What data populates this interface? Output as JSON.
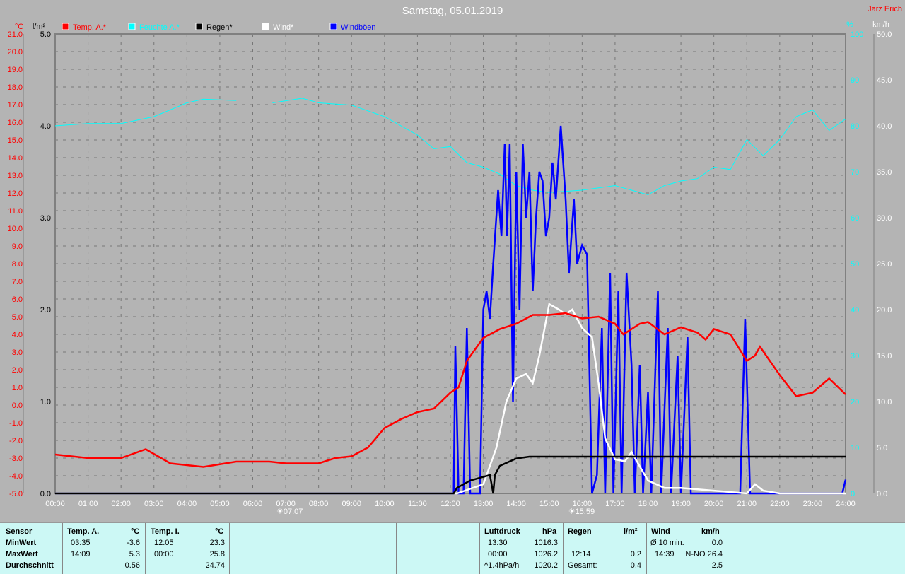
{
  "title": "Samstag, 05.01.2019",
  "author": "Jarz Erich",
  "colors": {
    "temp": "#ff0000",
    "hum": "#00ffff",
    "rain": "#000000",
    "wind": "#ffffff",
    "gust": "#0000ff"
  },
  "chart_data": {
    "type": "line",
    "title": "Samstag, 05.01.2019",
    "legend": [
      "Temp. A.*",
      "Feuchte A.*",
      "Regen*",
      "Wind*",
      "Windböen"
    ],
    "legend_placement": "top-left",
    "axes": {
      "left_temp": {
        "unit": "°C",
        "range": [
          -5,
          21
        ],
        "ticks": [
          "21.0",
          "20.0",
          "19.0",
          "18.0",
          "17.0",
          "16.0",
          "15.0",
          "14.0",
          "13.0",
          "12.0",
          "11.0",
          "10.0",
          "9.0",
          "8.0",
          "7.0",
          "6.0",
          "5.0",
          "4.0",
          "3.0",
          "2.0",
          "1.0",
          "0.0",
          "-1.0",
          "-2.0",
          "-3.0",
          "-4.0",
          "-5.0"
        ]
      },
      "left_rain": {
        "unit": "l/m²",
        "range": [
          0,
          5
        ],
        "ticks": [
          "5.0",
          "4.0",
          "3.0",
          "2.0",
          "1.0",
          "0.0"
        ]
      },
      "right_hum": {
        "unit": "%",
        "range": [
          0,
          100
        ],
        "ticks": [
          "100",
          "90",
          "80",
          "70",
          "60",
          "50",
          "40",
          "30",
          "20",
          "10",
          "0"
        ]
      },
      "right_wind": {
        "unit": "km/h",
        "range": [
          0,
          50
        ],
        "ticks": [
          "50.0",
          "45.0",
          "40.0",
          "35.0",
          "30.0",
          "25.0",
          "20.0",
          "15.0",
          "10.0",
          "5.0",
          "0.0"
        ]
      },
      "x": {
        "range": [
          0,
          24
        ],
        "ticks": [
          "00:00",
          "01:00",
          "02:00",
          "03:00",
          "04:00",
          "05:00",
          "06:00",
          "07:00",
          "08:00",
          "09:00",
          "10:00",
          "11:00",
          "12:00",
          "13:00",
          "14:00",
          "15:00",
          "16:00",
          "17:00",
          "18:00",
          "19:00",
          "20:00",
          "21:00",
          "22:00",
          "23:00",
          "24:00"
        ]
      }
    },
    "grid": true,
    "sun": [
      {
        "label": "07:07",
        "t": 7.12
      },
      {
        "label": "15:59",
        "t": 15.98
      }
    ],
    "series": [
      {
        "name": "Temp. A.",
        "axis": "left_temp",
        "points": [
          [
            0,
            -2.8
          ],
          [
            1,
            -3.0
          ],
          [
            2,
            -3.0
          ],
          [
            2.75,
            -2.5
          ],
          [
            3.5,
            -3.3
          ],
          [
            4.5,
            -3.5
          ],
          [
            5.5,
            -3.2
          ],
          [
            6.5,
            -3.2
          ],
          [
            7,
            -3.3
          ],
          [
            8,
            -3.3
          ],
          [
            8.5,
            -3.0
          ],
          [
            9,
            -2.9
          ],
          [
            9.5,
            -2.4
          ],
          [
            10,
            -1.3
          ],
          [
            10.5,
            -0.8
          ],
          [
            11,
            -0.4
          ],
          [
            11.5,
            -0.2
          ],
          [
            12,
            0.7
          ],
          [
            12.25,
            1.0
          ],
          [
            12.5,
            2.5
          ],
          [
            13,
            3.8
          ],
          [
            13.5,
            4.3
          ],
          [
            14,
            4.6
          ],
          [
            14.5,
            5.1
          ],
          [
            15,
            5.1
          ],
          [
            15.5,
            5.2
          ],
          [
            16,
            4.9
          ],
          [
            16.5,
            5.0
          ],
          [
            17,
            4.6
          ],
          [
            17.25,
            4.0
          ],
          [
            17.75,
            4.6
          ],
          [
            18,
            4.7
          ],
          [
            18.5,
            4.0
          ],
          [
            19,
            4.4
          ],
          [
            19.5,
            4.1
          ],
          [
            19.75,
            3.7
          ],
          [
            20,
            4.3
          ],
          [
            20.5,
            4.0
          ],
          [
            21,
            2.5
          ],
          [
            21.25,
            2.8
          ],
          [
            21.4,
            3.3
          ],
          [
            22,
            1.7
          ],
          [
            22.5,
            0.5
          ],
          [
            23,
            0.7
          ],
          [
            23.5,
            1.5
          ],
          [
            24,
            0.6
          ]
        ]
      },
      {
        "name": "Feuchte A.",
        "axis": "right_hum",
        "points": [
          [
            0,
            80
          ],
          [
            1,
            80.5
          ],
          [
            2,
            80.5
          ],
          [
            3,
            82
          ],
          [
            4,
            85
          ],
          [
            4.5,
            85.8
          ],
          [
            5.5,
            85.5
          ],
          [
            6.2,
            null
          ],
          [
            6.6,
            85
          ],
          [
            7.5,
            86
          ],
          [
            8,
            85
          ],
          [
            9,
            84.5
          ],
          [
            10,
            82
          ],
          [
            11,
            78
          ],
          [
            11.5,
            75
          ],
          [
            12,
            75.5
          ],
          [
            12.5,
            72
          ],
          [
            13,
            71
          ],
          [
            13.5,
            69.5
          ],
          [
            14,
            67
          ],
          [
            14.5,
            66
          ],
          [
            15,
            65.5
          ],
          [
            16,
            66
          ],
          [
            17,
            67
          ],
          [
            17.5,
            66
          ],
          [
            18,
            65
          ],
          [
            18.5,
            67
          ],
          [
            19,
            68
          ],
          [
            19.5,
            68.5
          ],
          [
            20,
            71
          ],
          [
            20.5,
            70.5
          ],
          [
            21,
            77
          ],
          [
            21.5,
            73.5
          ],
          [
            22,
            77
          ],
          [
            22.5,
            82
          ],
          [
            23,
            83.5
          ],
          [
            23.5,
            79
          ],
          [
            24,
            81.5
          ]
        ]
      },
      {
        "name": "Regen",
        "axis": "left_rain",
        "points": [
          [
            0,
            0
          ],
          [
            12.1,
            0
          ],
          [
            12.2,
            0.06
          ],
          [
            12.6,
            0.14
          ],
          [
            13,
            0.18
          ],
          [
            13.2,
            0.2
          ],
          [
            13.3,
            0.0
          ],
          [
            13.35,
            0.2
          ],
          [
            13.5,
            0.3
          ],
          [
            14,
            0.38
          ],
          [
            14.4,
            0.4
          ],
          [
            24,
            0.4
          ]
        ]
      },
      {
        "name": "Wind",
        "axis": "right_wind",
        "points": [
          [
            0,
            0
          ],
          [
            12.2,
            0
          ],
          [
            12.6,
            0.5
          ],
          [
            13,
            1
          ],
          [
            13.4,
            5
          ],
          [
            13.7,
            10
          ],
          [
            14,
            12.5
          ],
          [
            14.3,
            13
          ],
          [
            14.5,
            12
          ],
          [
            14.7,
            15
          ],
          [
            15,
            20.6
          ],
          [
            15.3,
            20
          ],
          [
            15.5,
            19.5
          ],
          [
            15.7,
            20
          ],
          [
            16,
            18
          ],
          [
            16.3,
            17
          ],
          [
            16.5,
            12
          ],
          [
            16.7,
            6
          ],
          [
            17,
            3.7
          ],
          [
            17.3,
            3.5
          ],
          [
            17.5,
            4.5
          ],
          [
            18,
            1.4
          ],
          [
            18.5,
            0.6
          ],
          [
            19,
            0.6
          ],
          [
            20,
            0.3
          ],
          [
            21,
            0
          ],
          [
            21.25,
            1
          ],
          [
            21.5,
            0.3
          ],
          [
            22,
            0
          ],
          [
            24,
            0
          ]
        ]
      },
      {
        "name": "Windböen",
        "axis": "right_wind",
        "points": [
          [
            0,
            0
          ],
          [
            12.1,
            0
          ],
          [
            12.15,
            16
          ],
          [
            12.25,
            0
          ],
          [
            12.4,
            0
          ],
          [
            12.5,
            18
          ],
          [
            12.6,
            0
          ],
          [
            12.9,
            0
          ],
          [
            13,
            20
          ],
          [
            13.1,
            22
          ],
          [
            13.2,
            19
          ],
          [
            13.3,
            25
          ],
          [
            13.45,
            33
          ],
          [
            13.55,
            28
          ],
          [
            13.65,
            38
          ],
          [
            13.72,
            28
          ],
          [
            13.8,
            38
          ],
          [
            13.9,
            10
          ],
          [
            14,
            35
          ],
          [
            14.1,
            20
          ],
          [
            14.2,
            38
          ],
          [
            14.3,
            30
          ],
          [
            14.4,
            35
          ],
          [
            14.5,
            22
          ],
          [
            14.6,
            30
          ],
          [
            14.7,
            35
          ],
          [
            14.8,
            34
          ],
          [
            14.9,
            28
          ],
          [
            15,
            30
          ],
          [
            15.1,
            36
          ],
          [
            15.2,
            32
          ],
          [
            15.35,
            40
          ],
          [
            15.5,
            32
          ],
          [
            15.6,
            24
          ],
          [
            15.75,
            32
          ],
          [
            15.85,
            25
          ],
          [
            16,
            27
          ],
          [
            16.15,
            26
          ],
          [
            16.3,
            0
          ],
          [
            16.45,
            2
          ],
          [
            16.6,
            18
          ],
          [
            16.7,
            0
          ],
          [
            16.85,
            24
          ],
          [
            16.95,
            0
          ],
          [
            17.1,
            22
          ],
          [
            17.2,
            0
          ],
          [
            17.35,
            24
          ],
          [
            17.5,
            14
          ],
          [
            17.6,
            0
          ],
          [
            17.75,
            14
          ],
          [
            17.85,
            0
          ],
          [
            18,
            11
          ],
          [
            18.1,
            0
          ],
          [
            18.3,
            22
          ],
          [
            18.4,
            0
          ],
          [
            18.6,
            18
          ],
          [
            18.7,
            0
          ],
          [
            18.9,
            15
          ],
          [
            19,
            0
          ],
          [
            19.2,
            17
          ],
          [
            19.3,
            0
          ],
          [
            20.8,
            0
          ],
          [
            20.95,
            19
          ],
          [
            21.1,
            0
          ],
          [
            23.9,
            0
          ],
          [
            24,
            1.5
          ]
        ]
      }
    ]
  },
  "table": {
    "temp_a": {
      "sensor": "Sensor",
      "min": "MinWert",
      "max": "MaxWert",
      "avg": "Durchschnitt",
      "head": "Temp. A.",
      "unit": "°C",
      "min_t": "03:35",
      "min_v": "-3.6",
      "max_t": "14:09",
      "max_v": "5.3",
      "avg_v": "0.56"
    },
    "temp_i": {
      "head": "Temp. I.",
      "unit": "°C",
      "min_t": "12:05",
      "min_v": "23.3",
      "max_t": "00:00",
      "max_v": "25.8",
      "avg_v": "24.74"
    },
    "press": {
      "head": "Luftdruck",
      "unit": "hPa",
      "min_t": "13:30",
      "min_v": "1016.3",
      "max_t": "00:00",
      "max_v": "1026.2",
      "trend": "^1.4hPa/h",
      "avg_v": "1020.2"
    },
    "rain": {
      "head": "Regen",
      "unit": "l/m²",
      "max_t": "12:14",
      "max_v": "0.2",
      "total_l": "Gesamt:",
      "total_v": "0.4"
    },
    "wind": {
      "head": "Wind",
      "unit": "km/h",
      "avg10_l": "Ø 10 min.",
      "avg10_v": "0.0",
      "max_t": "14:39",
      "max_v": "N-NO 26.4",
      "avg_v": "2.5"
    }
  }
}
